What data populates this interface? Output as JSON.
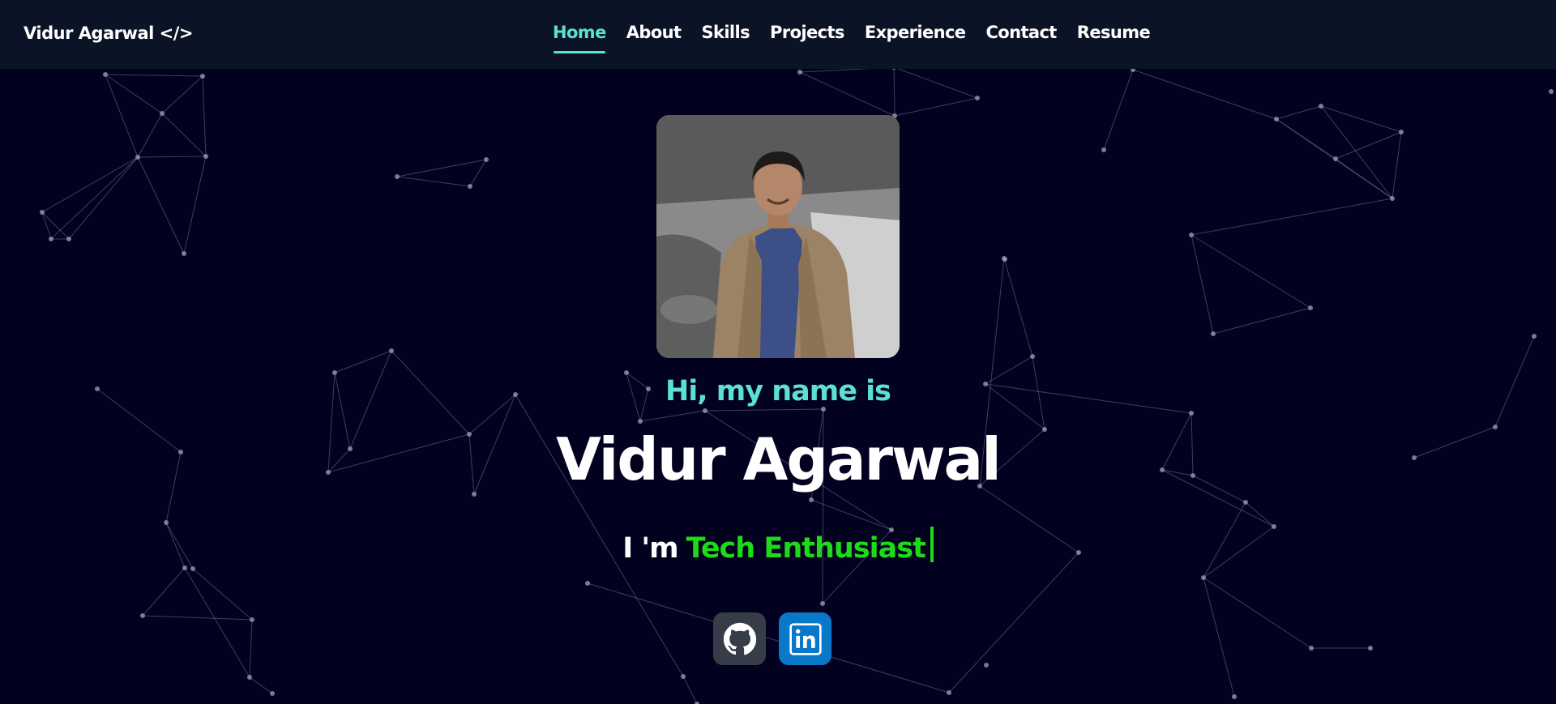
{
  "brand": {
    "text": "Vidur Agarwal </>"
  },
  "nav": {
    "items": [
      {
        "label": "Home",
        "active": true
      },
      {
        "label": "About",
        "active": false
      },
      {
        "label": "Skills",
        "active": false
      },
      {
        "label": "Projects",
        "active": false
      },
      {
        "label": "Experience",
        "active": false
      },
      {
        "label": "Contact",
        "active": false
      },
      {
        "label": "Resume",
        "active": false
      }
    ]
  },
  "hero": {
    "greeting": "Hi, my name is",
    "name": "Vidur Agarwal",
    "tagline_prefix": "I 'm",
    "tagline_typed": "Tech Enthusiast"
  },
  "socials": [
    {
      "icon": "github-icon"
    },
    {
      "icon": "linkedin-icon"
    }
  ],
  "colors": {
    "background": "#02011f",
    "navbar": "#0b1426",
    "accent": "#5ce1d1",
    "typed_text": "#1ddb18",
    "github_button": "#363d48",
    "linkedin_button": "#0a78c8"
  }
}
